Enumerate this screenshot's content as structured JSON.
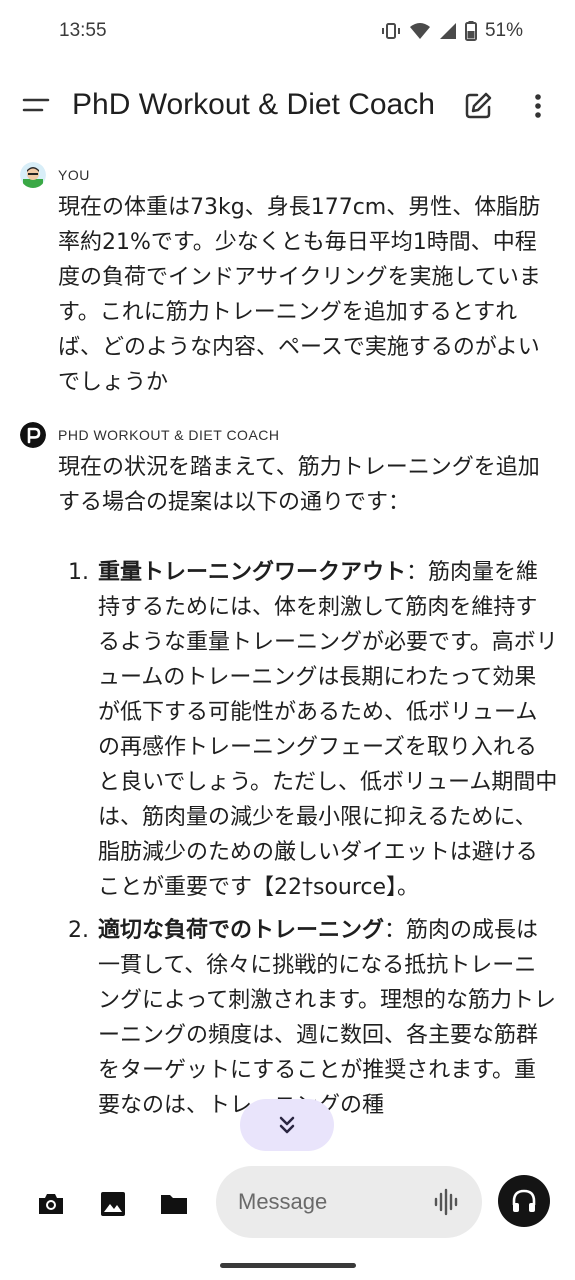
{
  "status": {
    "time": "13:55",
    "battery": "51%"
  },
  "header": {
    "title": "PhD Workout & Diet Coach"
  },
  "messages": [
    {
      "sender": "YOU",
      "text": "現在の体重は73kg、身長177cm、男性、体脂肪率約21%です。少なくとも毎日平均1時間、中程度の負荷でインドアサイクリングを実施しています。これに筋力トレーニングを追加するとすれば、どのような内容、ペースで実施するのがよいでしょうか"
    },
    {
      "sender": "PHD WORKOUT & DIET COACH",
      "intro": "現在の状況を踏まえて、筋力トレーニングを追加する場合の提案は以下の通りです：",
      "items": [
        {
          "num": "1.",
          "title": "重量トレーニングワークアウト",
          "text": "：筋肉量を維持するためには、体を刺激して筋肉を維持するような重量トレーニングが必要です。高ボリュームのトレーニングは長期にわたって効果が低下する可能性があるため、低ボリュームの再感作トレーニングフェーズを取り入れると良いでしょう。ただし、低ボリューム期間中は、筋肉量の減少を最小限に抑えるために、脂肪減少のための厳しいダイエットは避けることが重要です【22†source】。"
        },
        {
          "num": "2.",
          "title": "適切な負荷でのトレーニング",
          "text": "：筋肉の成長は一貫して、徐々に挑戦的になる抵抗トレーニングによって刺激されます。理想的な筋力トレーニングの頻度は、週に数回、各主要な筋群をターゲットにすることが推奨されます。重要なのは、トレーニングの種"
        }
      ]
    }
  ],
  "composer": {
    "placeholder": "Message"
  },
  "icons": {
    "menu": "menu-icon",
    "edit": "edit-icon",
    "more": "more-vertical-icon",
    "camera": "camera-icon",
    "image": "image-icon",
    "folder": "folder-icon",
    "waveform": "waveform-icon",
    "headphones": "headphones-icon",
    "scroll": "chevron-double-down-icon"
  },
  "colors": {
    "scroll_button_bg": "#e9e4fb",
    "input_bg": "#ebebeb",
    "voice_button_bg": "#141414"
  }
}
